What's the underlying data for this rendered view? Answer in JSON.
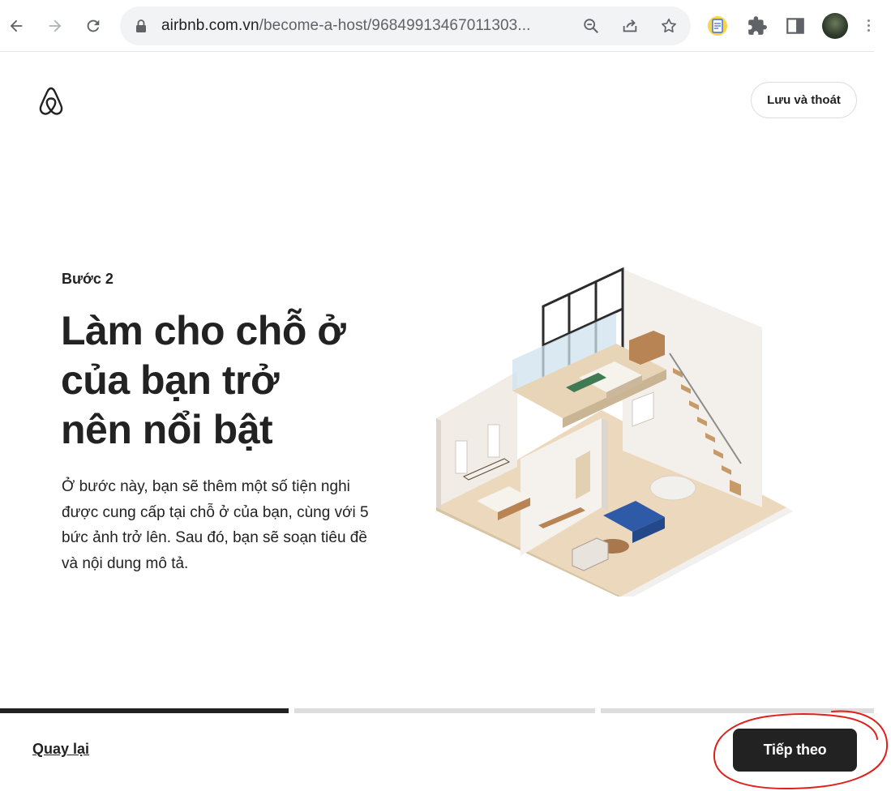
{
  "browser": {
    "url_host": "airbnb.com.vn",
    "url_path": "/become-a-host/96849913467011303..."
  },
  "header": {
    "save_exit_label": "Lưu và thoát"
  },
  "main": {
    "step_label": "Bước 2",
    "headline_lines": [
      "Làm cho chỗ ở",
      "của bạn trở",
      "nên nổi bật"
    ],
    "description": "Ở bước này, bạn sẽ thêm một số tiện nghi được cung cấp tại chỗ ở của bạn, cùng với 5 bức ảnh trở lên. Sau đó, bạn sẽ soạn tiêu đề và nội dung mô tả."
  },
  "progress": {
    "segments": [
      1.0,
      0.0,
      0.0
    ]
  },
  "footer": {
    "back_label": "Quay lại",
    "next_label": "Tiếp theo"
  },
  "colors": {
    "text": "#222222",
    "annotation": "#e0201c",
    "omnibox": "#f1f3f4"
  }
}
